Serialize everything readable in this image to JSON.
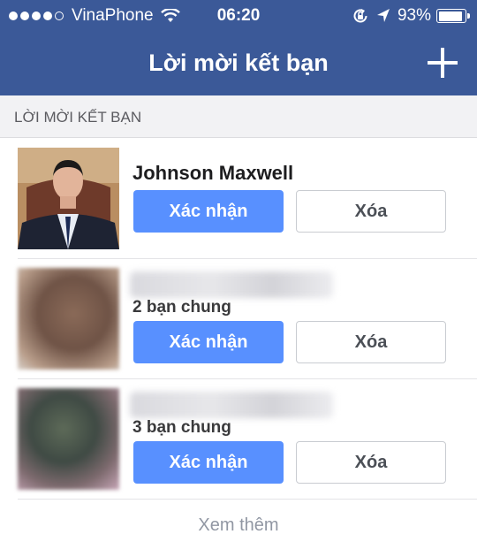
{
  "status_bar": {
    "carrier": "VinaPhone",
    "time": "06:20",
    "battery": "93%",
    "battery_level": 0.93
  },
  "nav": {
    "title": "Lời mời kết bạn"
  },
  "section": {
    "header": "LỜI MỜI KẾT BẠN"
  },
  "requests": [
    {
      "name": "Johnson Maxwell",
      "mutual": "",
      "confirm_label": "Xác nhận",
      "delete_label": "Xóa"
    },
    {
      "name": "",
      "mutual": "2 bạn chung",
      "confirm_label": "Xác nhận",
      "delete_label": "Xóa"
    },
    {
      "name": "",
      "mutual": "3 bạn chung",
      "confirm_label": "Xác nhận",
      "delete_label": "Xóa"
    }
  ],
  "footer": {
    "see_more": "Xem thêm"
  }
}
